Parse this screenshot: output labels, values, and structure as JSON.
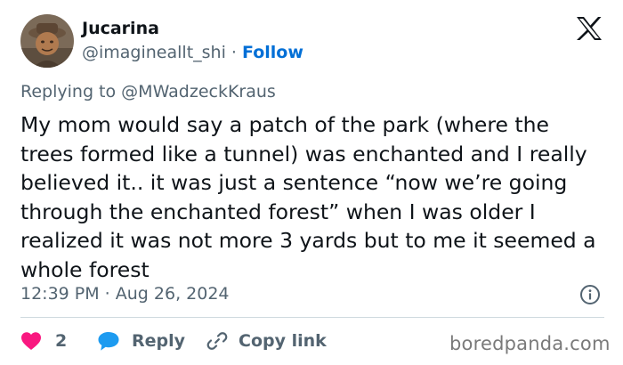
{
  "author": {
    "display_name": "Jucarina",
    "handle": "@imagineallt_shi",
    "separator": "·",
    "follow_label": "Follow",
    "avatar_icon": "avatar-photo"
  },
  "header": {
    "brand_icon": "x-logo-icon"
  },
  "reply_context": {
    "prefix": "Replying to",
    "handle": "@MWadzeckKraus"
  },
  "tweet": {
    "text": "My mom would say a patch of the park (where the trees formed like a tunnel) was enchanted and I really believed it.. it was just a sentence “now we’re going through the enchanted forest” when I was older I realized it was not more 3 yards but to me it seemed a whole forest",
    "timestamp": "12:39 PM · Aug 26, 2024"
  },
  "actions": {
    "like_count": "2",
    "reply_label": "Reply",
    "copy_label": "Copy link"
  },
  "colors": {
    "like": "#f91880",
    "reply": "#1d9bf0",
    "follow": "#006fd6",
    "secondary_text": "#536471",
    "divider": "#cfd9de"
  },
  "watermark": "boredpanda.com"
}
